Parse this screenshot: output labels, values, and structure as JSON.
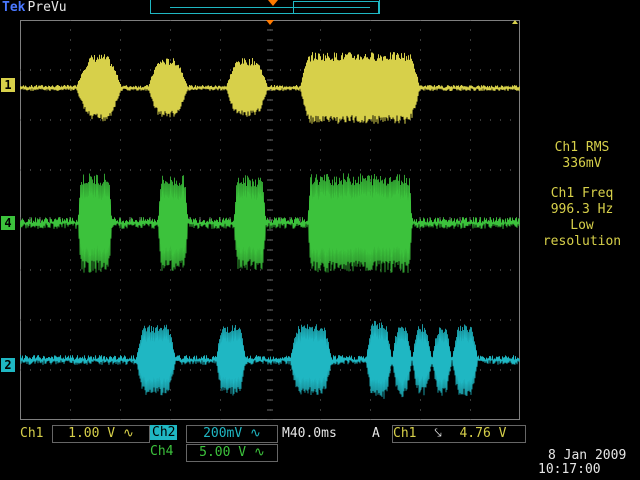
{
  "header": {
    "brand": "Tek",
    "mode": "PreVu"
  },
  "channel_markers": {
    "ch1": "1",
    "ch4": "4",
    "ch2": "2"
  },
  "measurements": {
    "rms_title": "Ch1 RMS",
    "rms_value": "336mV",
    "freq_title": "Ch1 Freq",
    "freq_value": "996.3 Hz",
    "freq_note_line1": "Low",
    "freq_note_line2": "resolution"
  },
  "status": {
    "ch1_label": "Ch1",
    "ch1_scale": "1.00 V",
    "ch1_coupling": "∿",
    "ch2_label": "Ch2",
    "ch2_scale": "200mV",
    "ch2_coupling": "∿",
    "timebase": "M40.0ms",
    "trigger_mode": "A",
    "trigger_source": "Ch1",
    "trigger_slope": "⤥",
    "trigger_level": "4.76 V",
    "ch4_label": "Ch4",
    "ch4_scale": "5.00 V",
    "ch4_coupling": "∿",
    "date": "8 Jan  2009",
    "time": "10:17:00"
  },
  "colors": {
    "ch1": "#d7d04a",
    "ch4": "#3cc23c",
    "ch2": "#1fb7c3",
    "trigger": "#ff7a00"
  }
}
